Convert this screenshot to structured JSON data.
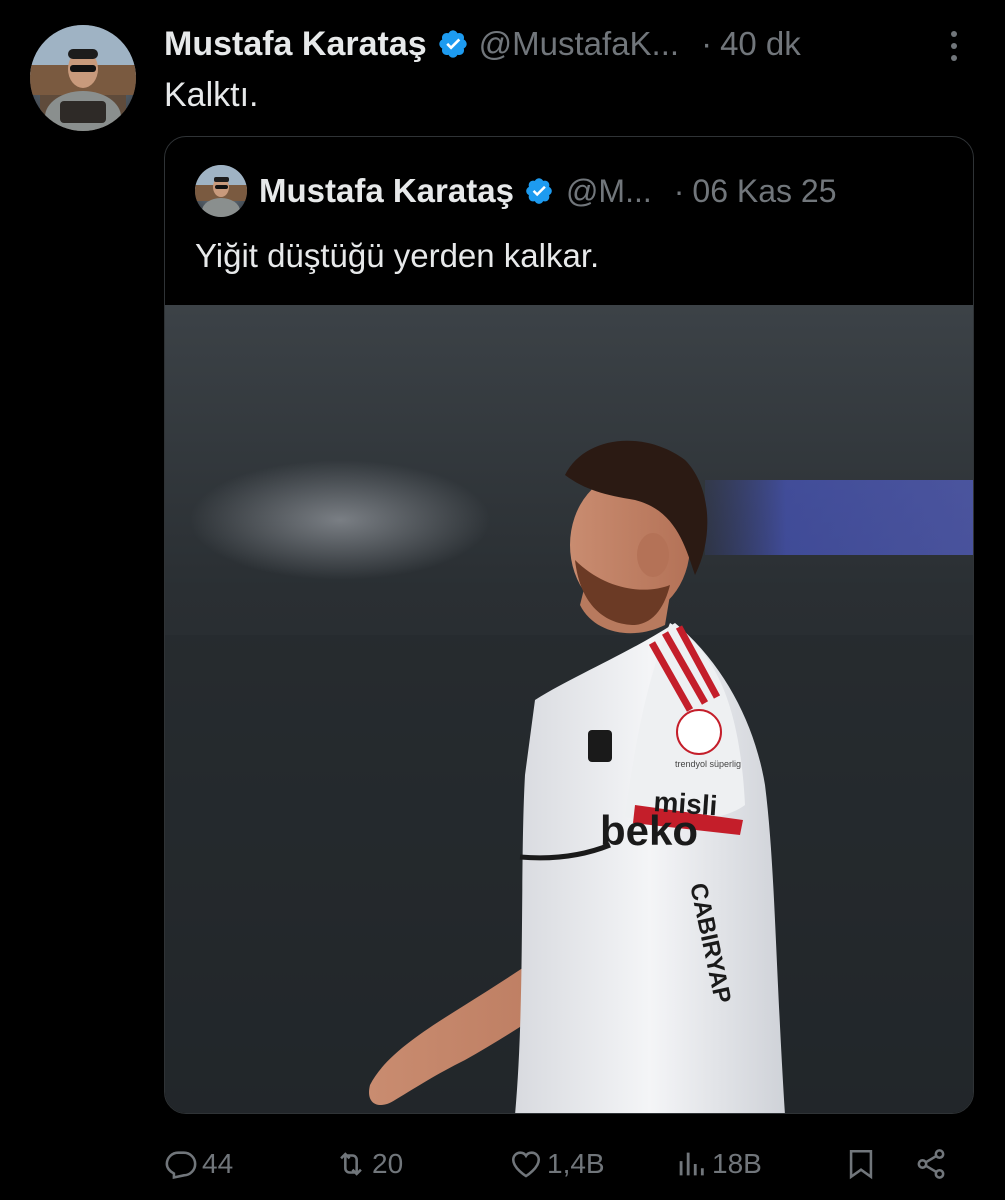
{
  "tweet": {
    "author_name": "Mustafa Karataş",
    "handle": "@MustafaK...",
    "separator": "·",
    "time": "40 dk",
    "text": "Kalktı."
  },
  "quoted": {
    "author_name": "Mustafa Karataş",
    "handle": "@M...",
    "separator": "·",
    "time": "06 Kas 25",
    "text": "Yiğit düştüğü yerden kalkar.",
    "media": {
      "jersey_sponsor_chest": "beko",
      "jersey_sponsor_sleeve": "misli",
      "jersey_side_text": "CABIRYAP",
      "jersey_patch": "trendyol süperlig"
    }
  },
  "actions": {
    "replies": "44",
    "reposts": "20",
    "likes": "1,4B",
    "views": "18B"
  },
  "colors": {
    "background": "#000000",
    "text_primary": "#e7e9ea",
    "text_secondary": "#71767b",
    "verified_blue": "#1d9bf0",
    "border": "#2f3336"
  },
  "icons": [
    "verified-badge-icon",
    "more-icon",
    "reply-icon",
    "repost-icon",
    "like-icon",
    "views-icon",
    "bookmark-icon",
    "share-icon"
  ]
}
